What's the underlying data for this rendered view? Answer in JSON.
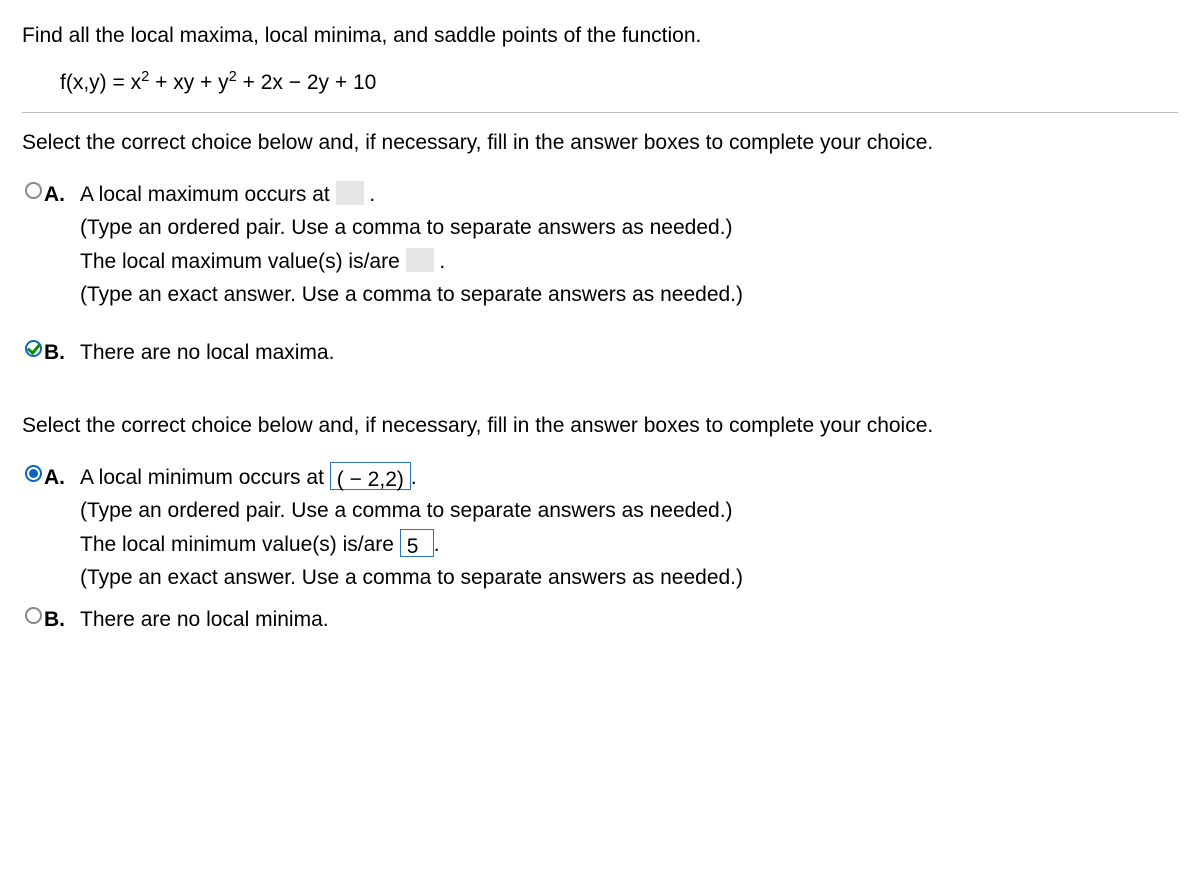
{
  "problem_statement": "Find all the local maxima, local minima, and saddle points of the function.",
  "equation_prefix": "f(x,y) = x",
  "equation_mid1": " + xy + y",
  "equation_mid2": " + 2x − 2y + 10",
  "instruction": "Select the correct choice below and, if necessary, fill in the answer boxes to complete your choice.",
  "q1": {
    "A": {
      "label": "A.",
      "l1_pre": "A local maximum occurs at ",
      "l1_post": " .",
      "hint1": "(Type an ordered pair. Use a comma to separate answers as needed.)",
      "l2_pre": "The local maximum value(s) is/are ",
      "l2_post": " .",
      "hint2": "(Type an exact answer. Use a comma to separate answers as needed.)"
    },
    "B": {
      "label": "B.",
      "text": "There are no local maxima."
    }
  },
  "q2": {
    "A": {
      "label": "A.",
      "l1_pre": "A local minimum occurs at ",
      "l1_post": ".",
      "ans1": "( − 2,2)",
      "hint1": "(Type an ordered pair. Use a comma to separate answers as needed.)",
      "l2_pre": "The local minimum value(s) is/are ",
      "l2_post": ".",
      "ans2": "5",
      "hint2": "(Type an exact answer. Use a comma to separate answers as needed.)"
    },
    "B": {
      "label": "B.",
      "text": "There are no local minima."
    }
  }
}
